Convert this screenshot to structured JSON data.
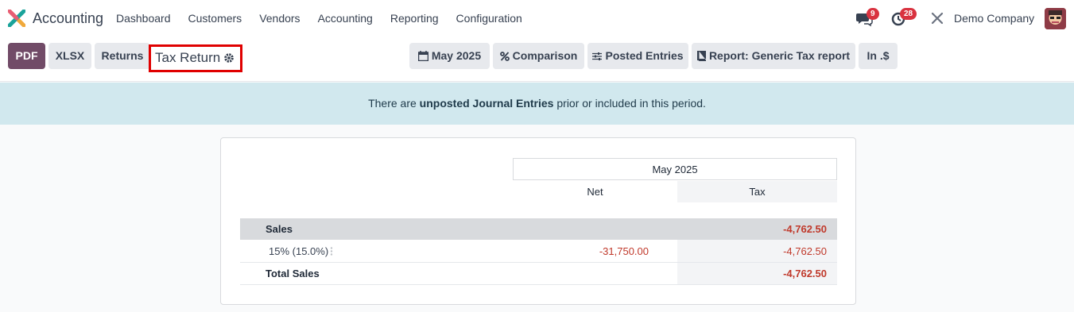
{
  "navbar": {
    "app_name": "Accounting",
    "menu": [
      "Dashboard",
      "Customers",
      "Vendors",
      "Accounting",
      "Reporting",
      "Configuration"
    ],
    "messages_badge": "9",
    "activities_badge": "28",
    "company": "Demo Company"
  },
  "control": {
    "pdf_label": "PDF",
    "xlsx_label": "XLSX",
    "returns_label": "Returns",
    "title": "Tax Return",
    "period_label": "May 2025",
    "comparison_label": "Comparison",
    "posted_label": "Posted Entries",
    "report_label": "Report: Generic Tax report",
    "currency_label": "In .$"
  },
  "alert": {
    "prefix": "There are ",
    "bold": "unposted Journal Entries",
    "suffix": " prior or included in this period."
  },
  "report": {
    "period": "May 2025",
    "col_net": "Net",
    "col_tax": "Tax",
    "rows": [
      {
        "label": "Sales",
        "net": "",
        "tax": "-4,762.50"
      },
      {
        "label": "15% (15.0%)",
        "net": "-31,750.00",
        "tax": "-4,762.50"
      },
      {
        "label": "Total Sales",
        "net": "",
        "tax": "-4,762.50"
      }
    ]
  },
  "colors": {
    "brand": "#714b67",
    "negative": "#c0392b",
    "alert_bg": "#d1e8ee"
  }
}
